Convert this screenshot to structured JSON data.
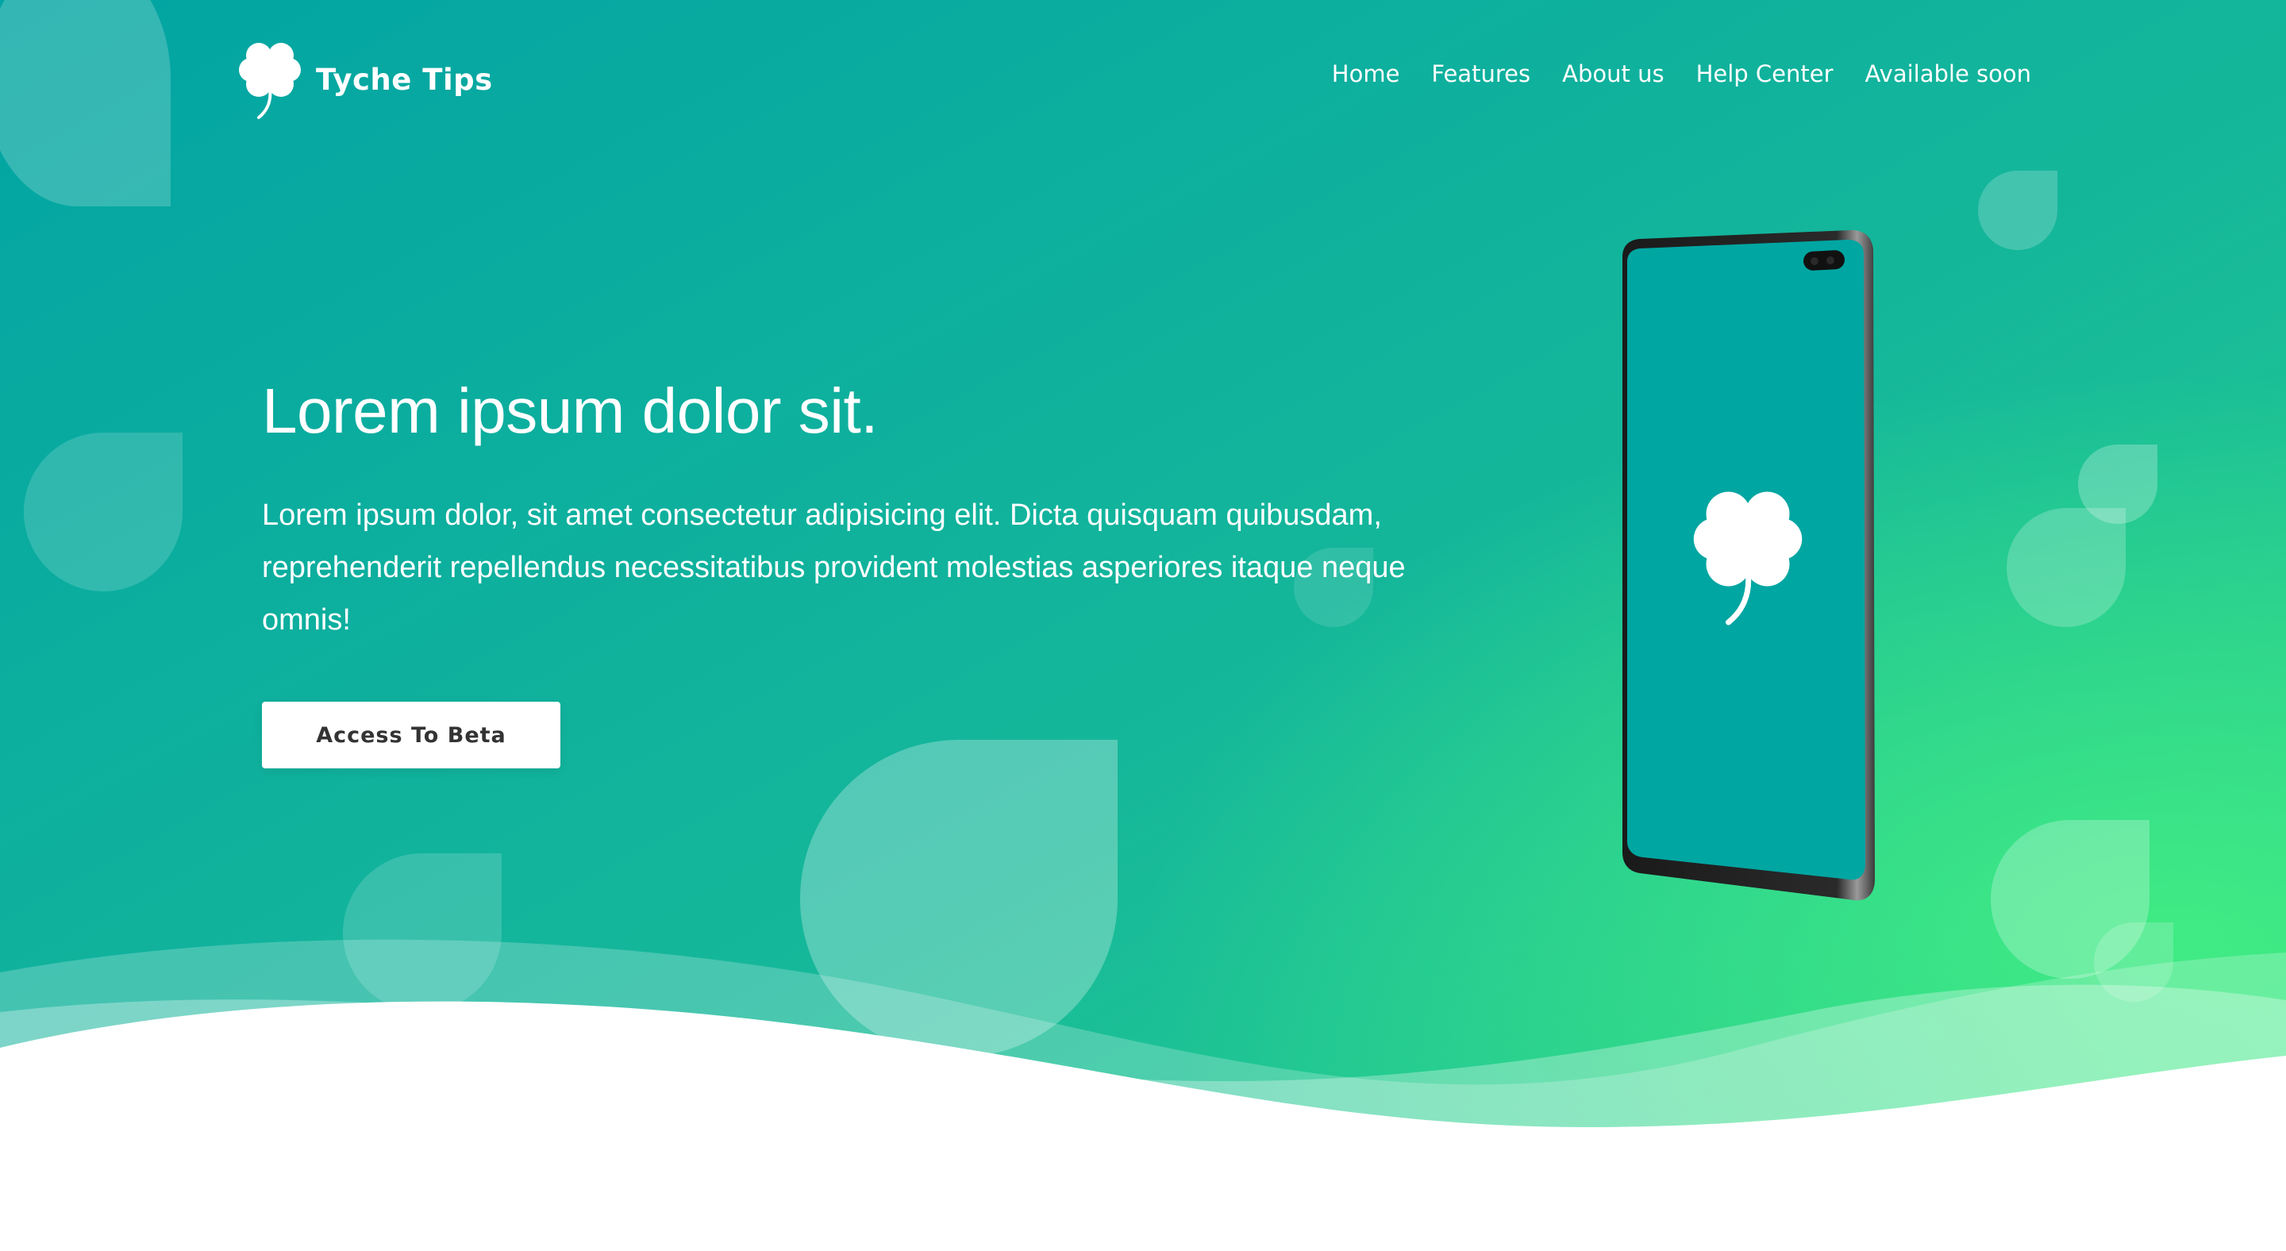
{
  "brand": {
    "name": "Tyche Tips",
    "logo_icon": "four-leaf-clover-icon"
  },
  "nav": {
    "items": [
      {
        "label": "Home"
      },
      {
        "label": "Features"
      },
      {
        "label": "About us"
      },
      {
        "label": "Help Center"
      },
      {
        "label": "Available soon"
      }
    ]
  },
  "hero": {
    "title": "Lorem ipsum dolor sit.",
    "text": "Lorem ipsum dolor, sit amet consectetur adipisicing elit. Dicta quisquam quibusdam, reprehenderit repellendus necessitatibus provident molestias asperiores itaque neque omnis!",
    "cta_label": "Access To Beta"
  },
  "phone": {
    "screen_icon": "four-leaf-clover-icon"
  },
  "colors": {
    "gradient_start": "#05a7a1",
    "gradient_end": "#3be686",
    "text": "#ffffff",
    "button_text": "#333333"
  }
}
